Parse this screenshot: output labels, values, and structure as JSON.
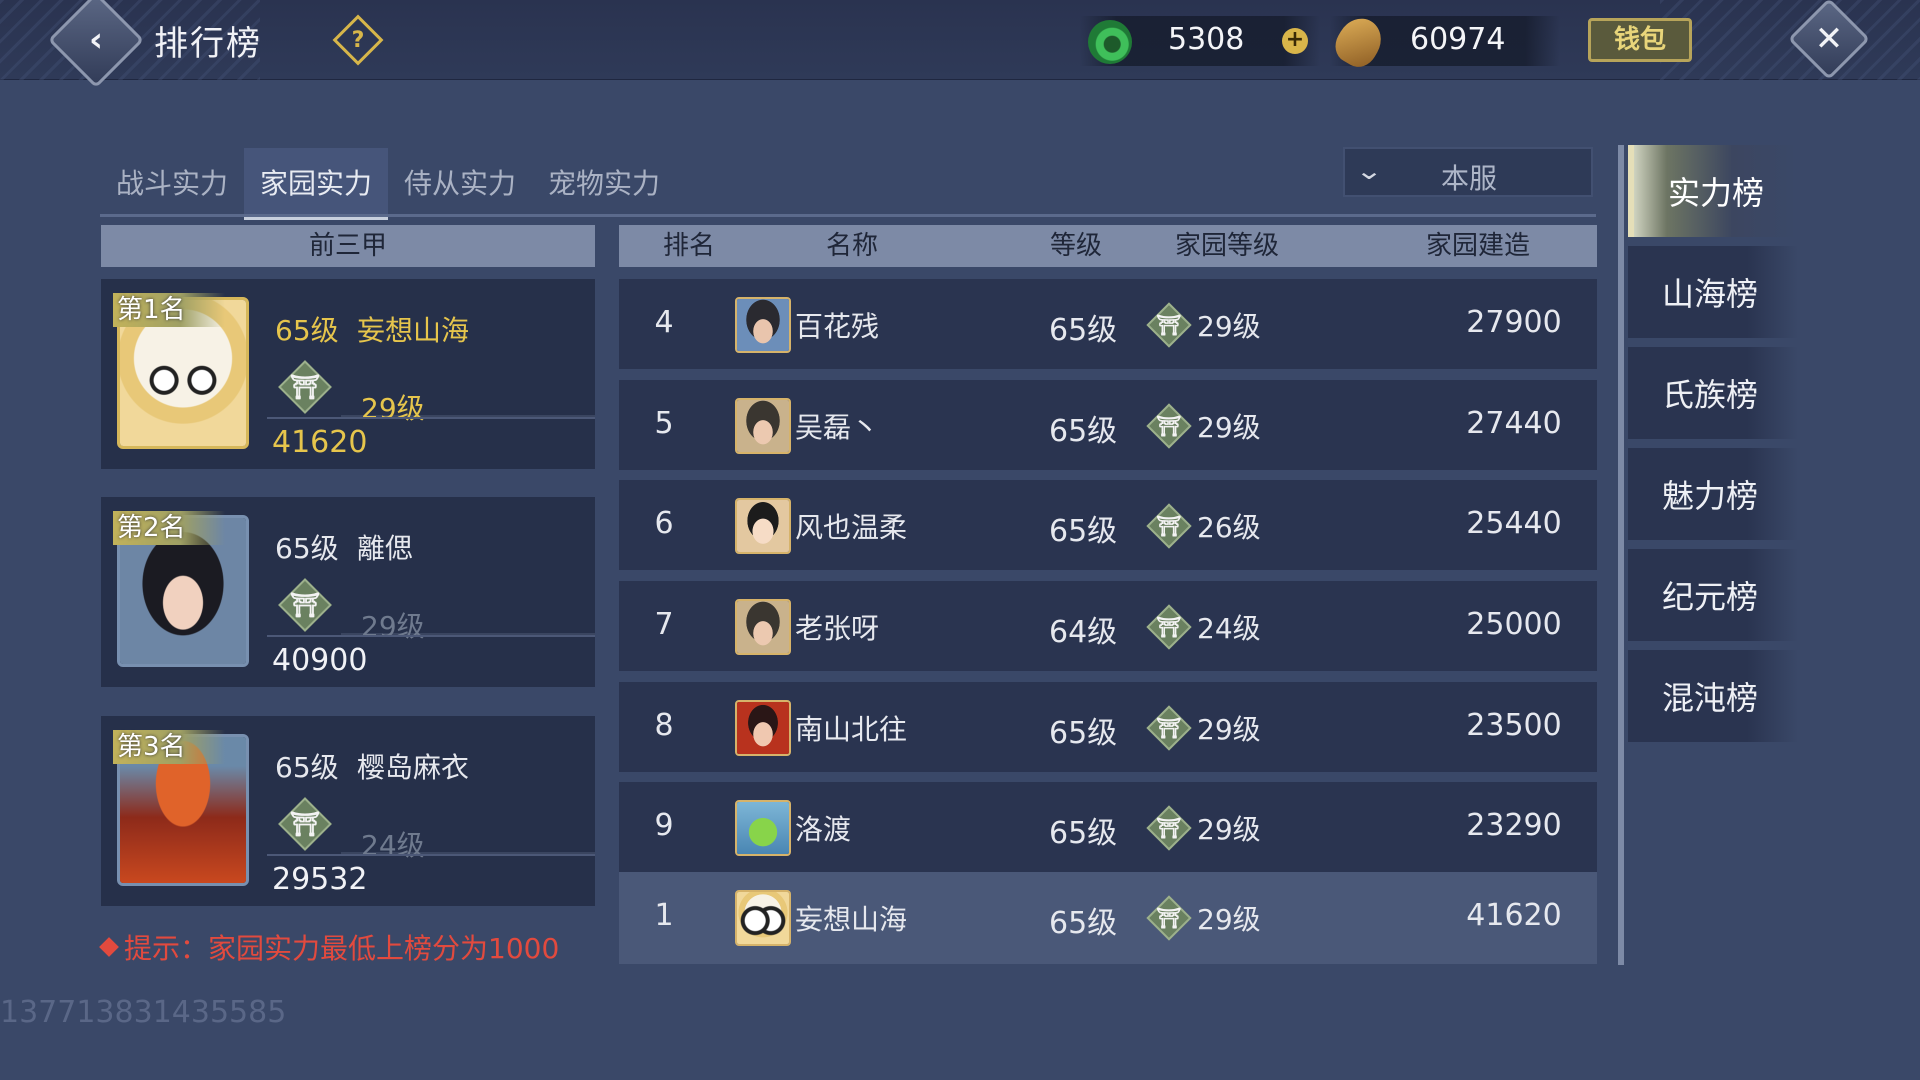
{
  "header": {
    "title": "排行榜",
    "currency_jade": "5308",
    "currency_shell": "60974",
    "wallet_label": "钱包",
    "back_icon": "back-arrow-icon",
    "help_icon": "question-icon",
    "close_icon": "close-icon"
  },
  "tabs": [
    {
      "label": "战斗实力",
      "active": false
    },
    {
      "label": "家园实力",
      "active": true
    },
    {
      "label": "侍从实力",
      "active": false
    },
    {
      "label": "宠物实力",
      "active": false
    }
  ],
  "server_filter": {
    "value": "本服"
  },
  "podium": {
    "header": "前三甲",
    "entries": [
      {
        "rank_label": "第1名",
        "level": "65级",
        "name": "妄想山海",
        "home_level": "29级",
        "score": "41620"
      },
      {
        "rank_label": "第2名",
        "level": "65级",
        "name": "離偲",
        "home_level": "29级",
        "score": "40900"
      },
      {
        "rank_label": "第3名",
        "level": "65级",
        "name": "樱岛麻衣",
        "home_level": "24级",
        "score": "29532"
      }
    ]
  },
  "table": {
    "columns": [
      "排名",
      "名称",
      "等级",
      "家园等级",
      "家园建造"
    ],
    "rows": [
      {
        "rank": "4",
        "name": "百花残",
        "level": "65级",
        "home_level": "29级",
        "score": "27900"
      },
      {
        "rank": "5",
        "name": "吴磊丶",
        "level": "65级",
        "home_level": "29级",
        "score": "27440"
      },
      {
        "rank": "6",
        "name": "风也温柔",
        "level": "65级",
        "home_level": "26级",
        "score": "25440"
      },
      {
        "rank": "7",
        "name": "老张呀",
        "level": "64级",
        "home_level": "24级",
        "score": "25000"
      },
      {
        "rank": "8",
        "name": "南山北往",
        "level": "65级",
        "home_level": "29级",
        "score": "23500"
      },
      {
        "rank": "9",
        "name": "洛渡",
        "level": "65级",
        "home_level": "29级",
        "score": "23290"
      }
    ],
    "my_row": {
      "rank": "1",
      "name": "妄想山海",
      "level": "65级",
      "home_level": "29级",
      "score": "41620"
    }
  },
  "hint": "提示：家园实力最低上榜分为1000",
  "watermark": "137713831435585",
  "sidebar": {
    "items": [
      {
        "label": "实力榜",
        "active": true
      },
      {
        "label": "山海榜",
        "active": false
      },
      {
        "label": "氏族榜",
        "active": false
      },
      {
        "label": "魅力榜",
        "active": false
      },
      {
        "label": "纪元榜",
        "active": false
      },
      {
        "label": "混沌榜",
        "active": false
      }
    ]
  },
  "colors": {
    "background": "#3a4868",
    "gold": "#e6c54c",
    "hint_red": "#e24a3e",
    "header_bar": "#7d8aa6"
  }
}
